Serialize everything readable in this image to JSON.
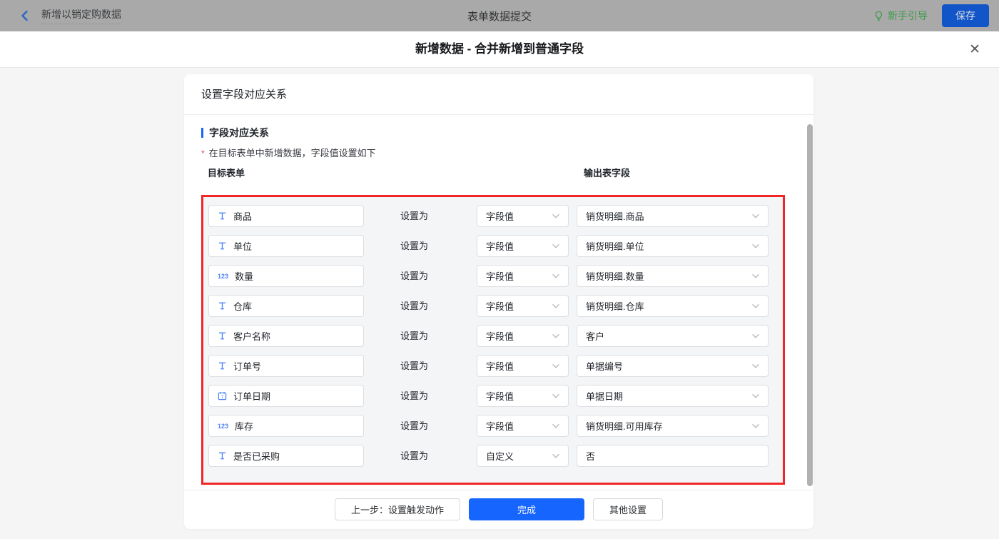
{
  "topbar": {
    "title": "新增以销定购数据",
    "center_title": "表单数据提交",
    "guide_label": "新手引导",
    "save_label": "保存"
  },
  "modal": {
    "title": "新增数据 - 合并新增到普通字段",
    "close_glyph": "✕"
  },
  "card": {
    "header": "设置字段对应关系",
    "section_title": "字段对应关系",
    "required_mark": "*",
    "note": "在目标表单中新增数据，字段值设置如下",
    "col_left": "目标表单",
    "col_right": "输出表字段"
  },
  "rows": [
    {
      "icon": "text",
      "field": "商品",
      "relation": "设置为",
      "type": "字段值",
      "value": "销货明细.商品",
      "value_dropdown": true
    },
    {
      "icon": "text",
      "field": "单位",
      "relation": "设置为",
      "type": "字段值",
      "value": "销货明细.单位",
      "value_dropdown": true
    },
    {
      "icon": "number",
      "field": "数量",
      "relation": "设置为",
      "type": "字段值",
      "value": "销货明细.数量",
      "value_dropdown": true
    },
    {
      "icon": "text",
      "field": "仓库",
      "relation": "设置为",
      "type": "字段值",
      "value": "销货明细.仓库",
      "value_dropdown": true
    },
    {
      "icon": "text",
      "field": "客户名称",
      "relation": "设置为",
      "type": "字段值",
      "value": "客户",
      "value_dropdown": true
    },
    {
      "icon": "text",
      "field": "订单号",
      "relation": "设置为",
      "type": "字段值",
      "value": "单据编号",
      "value_dropdown": true
    },
    {
      "icon": "date",
      "field": "订单日期",
      "relation": "设置为",
      "type": "字段值",
      "value": "单据日期",
      "value_dropdown": true
    },
    {
      "icon": "number",
      "field": "库存",
      "relation": "设置为",
      "type": "字段值",
      "value": "销货明细.可用库存",
      "value_dropdown": true
    },
    {
      "icon": "text",
      "field": "是否已采购",
      "relation": "设置为",
      "type": "自定义",
      "value": "否",
      "value_dropdown": false
    }
  ],
  "footer": {
    "prev_label": "上一步：设置触发动作",
    "done_label": "完成",
    "other_label": "其他设置"
  },
  "colors": {
    "topbar_bg": "#a9a9a9",
    "save_blue": "#1155c8",
    "guide_green": "#3e9a4b",
    "accent_blue": "#1665ff",
    "icon_blue": "#4c83f7",
    "frame_red": "#f12727"
  }
}
